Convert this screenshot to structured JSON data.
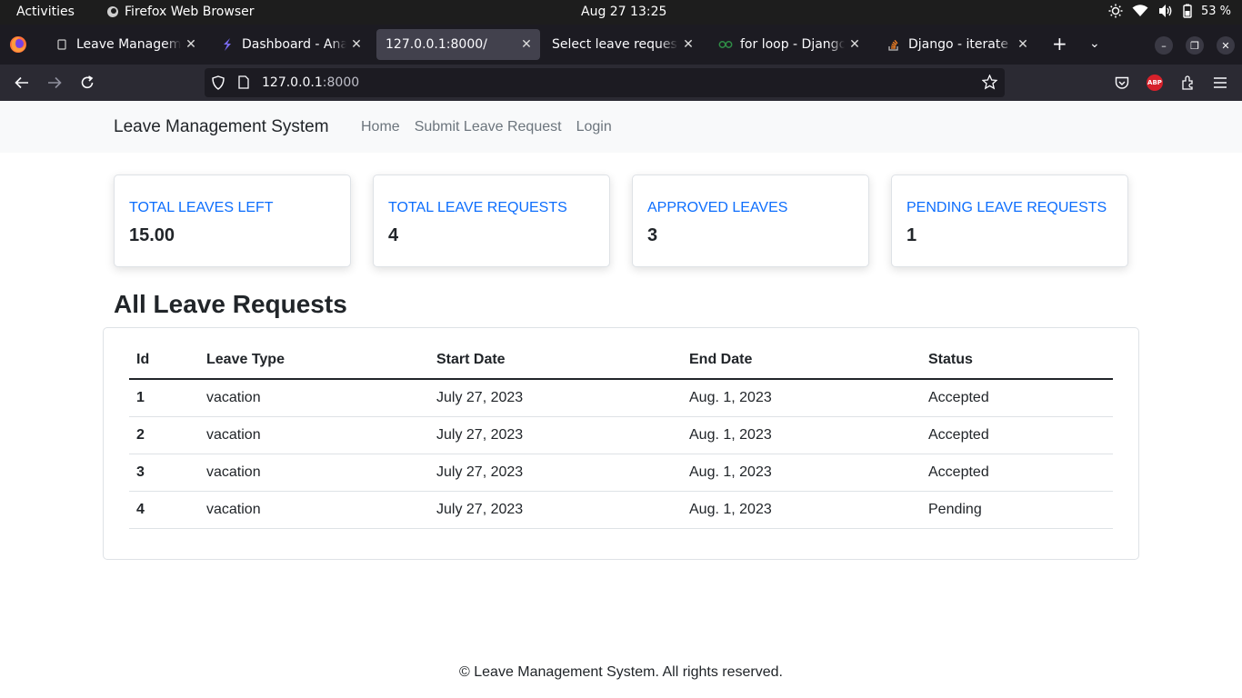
{
  "system": {
    "activities": "Activities",
    "app_name": "Firefox Web Browser",
    "clock": "Aug 27  13:25",
    "battery": "53 %"
  },
  "tabs": [
    {
      "title": "Leave Management",
      "icon": "page-icon",
      "active": false
    },
    {
      "title": "Dashboard - Analyt",
      "icon": "analytics-icon",
      "active": false
    },
    {
      "title": "127.0.0.1:8000/",
      "icon": "none",
      "active": true
    },
    {
      "title": "Select leave request to",
      "icon": "none",
      "active": false
    },
    {
      "title": "for loop - Django Te",
      "icon": "geeks-icon",
      "active": false
    },
    {
      "title": "Django - iterate nu",
      "icon": "stackoverflow-icon",
      "active": false
    }
  ],
  "urlbar": {
    "host": "127.0.0.1",
    "port": ":8000"
  },
  "site": {
    "brand": "Leave Management System",
    "nav": [
      "Home",
      "Submit Leave Request",
      "Login"
    ]
  },
  "stats": [
    {
      "label": "TOTAL LEAVES LEFT",
      "value": "15.00"
    },
    {
      "label": "TOTAL LEAVE REQUESTS",
      "value": "4"
    },
    {
      "label": "APPROVED LEAVES",
      "value": "3"
    },
    {
      "label": "PENDING LEAVE REQUESTS",
      "value": "1"
    }
  ],
  "requests": {
    "title": "All Leave Requests",
    "columns": [
      "Id",
      "Leave Type",
      "Start Date",
      "End Date",
      "Status"
    ],
    "rows": [
      [
        "1",
        "vacation",
        "July 27, 2023",
        "Aug. 1, 2023",
        "Accepted"
      ],
      [
        "2",
        "vacation",
        "July 27, 2023",
        "Aug. 1, 2023",
        "Accepted"
      ],
      [
        "3",
        "vacation",
        "July 27, 2023",
        "Aug. 1, 2023",
        "Accepted"
      ],
      [
        "4",
        "vacation",
        "July 27, 2023",
        "Aug. 1, 2023",
        "Pending"
      ]
    ]
  },
  "footer": "© Leave Management System. All rights reserved."
}
